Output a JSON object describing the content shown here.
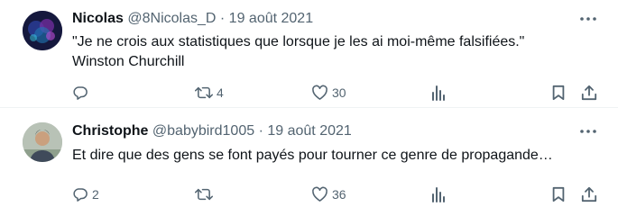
{
  "tweets": [
    {
      "name": "Nicolas",
      "handle": "@8Nicolas_D",
      "separator": "·",
      "date": "19 août 2021",
      "lines": [
        "\"Je ne crois aux statistiques que lorsque je les ai moi-même falsifiées.\"",
        "Winston Churchill"
      ],
      "reply_count": "",
      "retweet_count": "4",
      "like_count": "30"
    },
    {
      "name": "Christophe",
      "handle": "@babybird1005",
      "separator": "·",
      "date": "19 août 2021",
      "lines": [
        "Et dire que des gens se font payés pour tourner ce genre de propagande…"
      ],
      "reply_count": "2",
      "retweet_count": "",
      "like_count": "36"
    }
  ],
  "icons": [
    "more-icon",
    "reply-icon",
    "retweet-icon",
    "like-icon",
    "views-icon",
    "bookmark-icon",
    "share-icon"
  ],
  "colors": {
    "text": "#0f1419",
    "secondary": "#536471",
    "divider": "#eff3f4"
  }
}
